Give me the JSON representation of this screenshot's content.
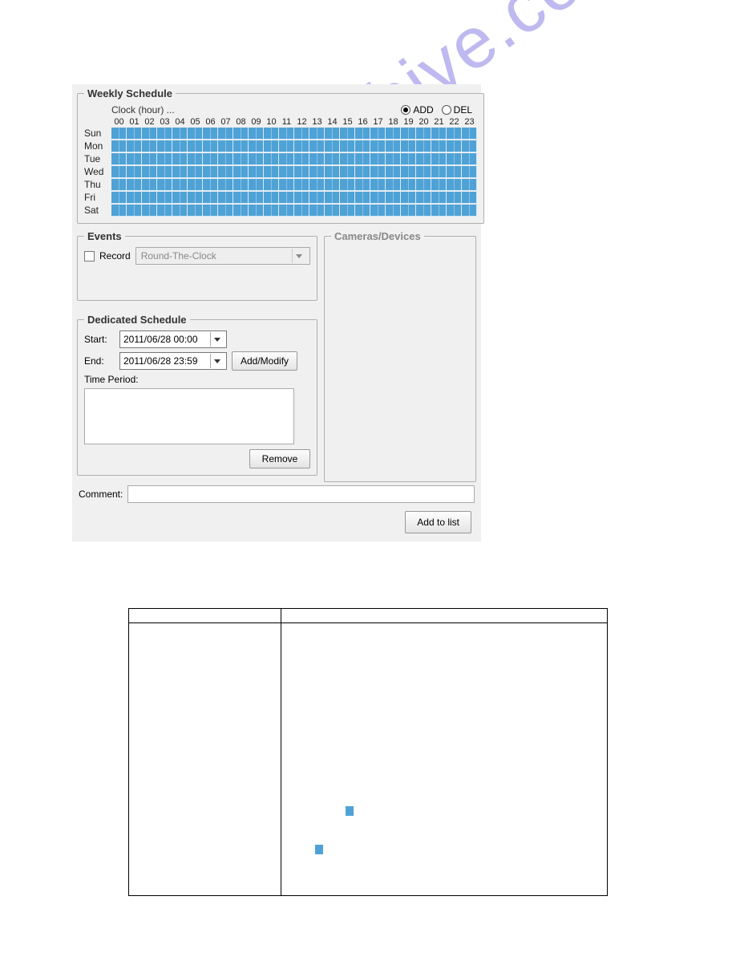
{
  "weekly": {
    "title": "Weekly Schedule",
    "clock_label": "Clock (hour) ...",
    "mode_add": "ADD",
    "mode_del": "DEL",
    "mode_selected": "ADD",
    "hours": [
      "00",
      "01",
      "02",
      "03",
      "04",
      "05",
      "06",
      "07",
      "08",
      "09",
      "10",
      "11",
      "12",
      "13",
      "14",
      "15",
      "16",
      "17",
      "18",
      "19",
      "20",
      "21",
      "22",
      "23"
    ],
    "days": [
      "Sun",
      "Mon",
      "Tue",
      "Wed",
      "Thu",
      "Fri",
      "Sat"
    ]
  },
  "events": {
    "title": "Events",
    "record_label": "Record",
    "record_checked": false,
    "select_value": "Round-The-Clock"
  },
  "cameras": {
    "title": "Cameras/Devices"
  },
  "dedicated": {
    "title": "Dedicated Schedule",
    "start_label": "Start:",
    "end_label": "End:",
    "start_value": "2011/06/28 00:00",
    "end_value": "2011/06/28 23:59",
    "addmodify_label": "Add/Modify",
    "time_period_label": "Time Period:",
    "remove_label": "Remove"
  },
  "comment": {
    "label": "Comment:",
    "value": ""
  },
  "addlist_label": "Add to list",
  "watermark_text": "manualshive.com"
}
